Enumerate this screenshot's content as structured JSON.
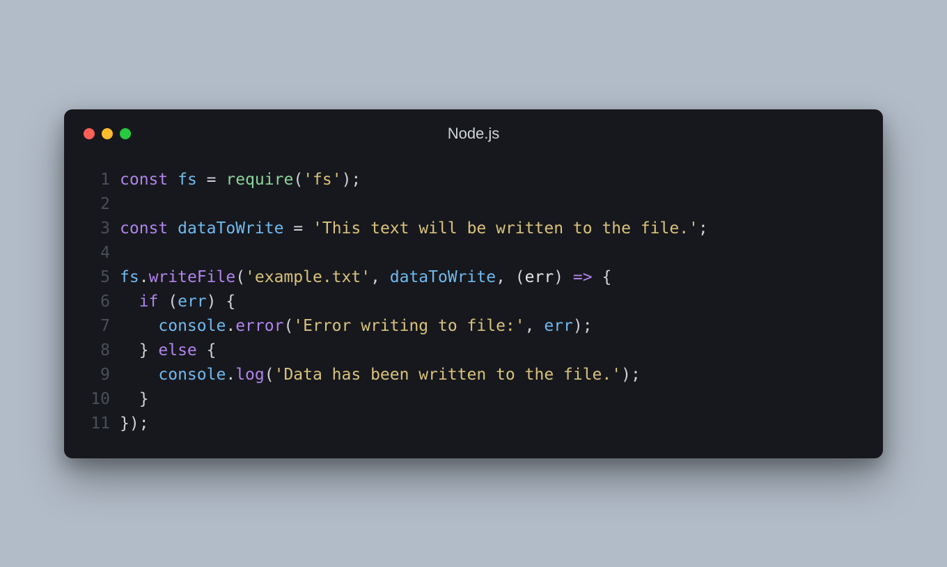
{
  "window": {
    "title": "Node.js"
  },
  "code": {
    "lines": [
      {
        "n": "1",
        "tokens": [
          {
            "c": "kw",
            "t": "const"
          },
          {
            "c": "punc",
            "t": " "
          },
          {
            "c": "var",
            "t": "fs"
          },
          {
            "c": "punc",
            "t": " "
          },
          {
            "c": "op",
            "t": "="
          },
          {
            "c": "punc",
            "t": " "
          },
          {
            "c": "fn",
            "t": "require"
          },
          {
            "c": "punc",
            "t": "("
          },
          {
            "c": "str",
            "t": "'fs'"
          },
          {
            "c": "punc",
            "t": ");"
          }
        ]
      },
      {
        "n": "2",
        "tokens": []
      },
      {
        "n": "3",
        "tokens": [
          {
            "c": "kw",
            "t": "const"
          },
          {
            "c": "punc",
            "t": " "
          },
          {
            "c": "var",
            "t": "dataToWrite"
          },
          {
            "c": "punc",
            "t": " "
          },
          {
            "c": "op",
            "t": "="
          },
          {
            "c": "punc",
            "t": " "
          },
          {
            "c": "str",
            "t": "'This text will be written to the file.'"
          },
          {
            "c": "punc",
            "t": ";"
          }
        ]
      },
      {
        "n": "4",
        "tokens": []
      },
      {
        "n": "5",
        "tokens": [
          {
            "c": "var",
            "t": "fs"
          },
          {
            "c": "punc",
            "t": "."
          },
          {
            "c": "fn2",
            "t": "writeFile"
          },
          {
            "c": "punc",
            "t": "("
          },
          {
            "c": "str",
            "t": "'example.txt'"
          },
          {
            "c": "punc",
            "t": ", "
          },
          {
            "c": "var",
            "t": "dataToWrite"
          },
          {
            "c": "punc",
            "t": ", ("
          },
          {
            "c": "param",
            "t": "err"
          },
          {
            "c": "punc",
            "t": ") "
          },
          {
            "c": "arrow",
            "t": "=>"
          },
          {
            "c": "punc",
            "t": " {"
          }
        ]
      },
      {
        "n": "6",
        "tokens": [
          {
            "c": "punc",
            "t": "  "
          },
          {
            "c": "kw",
            "t": "if"
          },
          {
            "c": "punc",
            "t": " ("
          },
          {
            "c": "var",
            "t": "err"
          },
          {
            "c": "punc",
            "t": ") {"
          }
        ]
      },
      {
        "n": "7",
        "tokens": [
          {
            "c": "punc",
            "t": "    "
          },
          {
            "c": "var",
            "t": "console"
          },
          {
            "c": "punc",
            "t": "."
          },
          {
            "c": "fn2",
            "t": "error"
          },
          {
            "c": "punc",
            "t": "("
          },
          {
            "c": "str",
            "t": "'Error writing to file:'"
          },
          {
            "c": "punc",
            "t": ", "
          },
          {
            "c": "var",
            "t": "err"
          },
          {
            "c": "punc",
            "t": ");"
          }
        ]
      },
      {
        "n": "8",
        "tokens": [
          {
            "c": "punc",
            "t": "  } "
          },
          {
            "c": "kw",
            "t": "else"
          },
          {
            "c": "punc",
            "t": " {"
          }
        ]
      },
      {
        "n": "9",
        "tokens": [
          {
            "c": "punc",
            "t": "    "
          },
          {
            "c": "var",
            "t": "console"
          },
          {
            "c": "punc",
            "t": "."
          },
          {
            "c": "fn2",
            "t": "log"
          },
          {
            "c": "punc",
            "t": "("
          },
          {
            "c": "str",
            "t": "'Data has been written to the file.'"
          },
          {
            "c": "punc",
            "t": ");"
          }
        ]
      },
      {
        "n": "10",
        "tokens": [
          {
            "c": "punc",
            "t": "  }"
          }
        ]
      },
      {
        "n": "11",
        "tokens": [
          {
            "c": "punc",
            "t": "});"
          }
        ]
      }
    ]
  }
}
